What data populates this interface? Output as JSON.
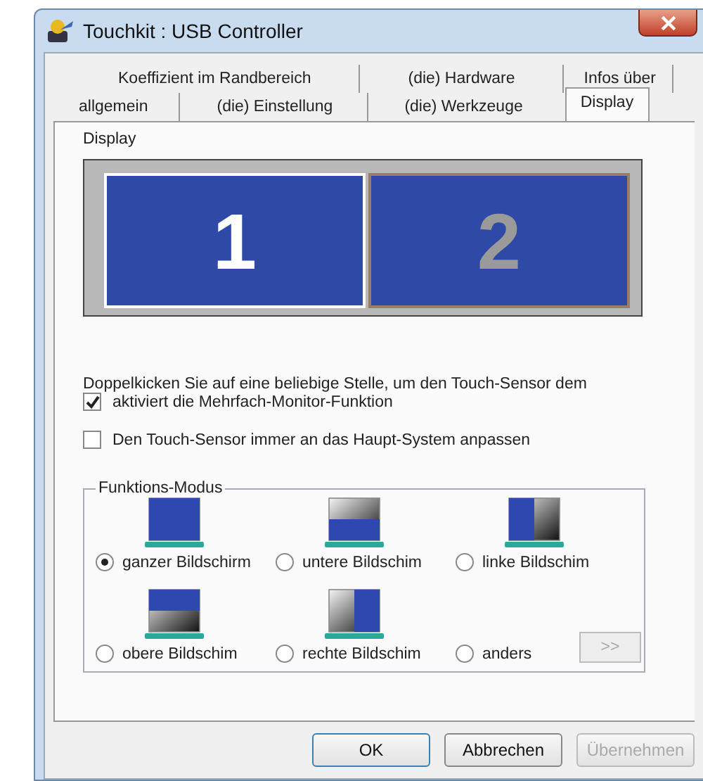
{
  "window": {
    "title": "Touchkit : USB Controller"
  },
  "tab_rows": [
    [
      {
        "label": "Koeffizient im Randbereich",
        "selected": false
      },
      {
        "label": "(die) Hardware",
        "selected": false
      },
      {
        "label": "Infos über",
        "selected": false
      }
    ],
    [
      {
        "label": "allgemein",
        "selected": false
      },
      {
        "label": "(die) Einstellung",
        "selected": false
      },
      {
        "label": "(die) Werkzeuge",
        "selected": false
      },
      {
        "label": "Display",
        "selected": true
      }
    ]
  ],
  "display_group": {
    "title": "Display",
    "monitors": [
      {
        "label": "1",
        "selected": true
      },
      {
        "label": "2",
        "selected": false
      }
    ]
  },
  "instruction": "Doppelkicken Sie auf eine beliebige Stelle, um den Touch-Sensor dem",
  "checkboxes": [
    {
      "label": "aktiviert die Mehrfach-Monitor-Funktion",
      "checked": true
    },
    {
      "label": "Den Touch-Sensor immer an das Haupt-System anpassen",
      "checked": false
    }
  ],
  "mode_group": {
    "title": "Funktions-Modus",
    "options": [
      {
        "label": "ganzer Bildschirm",
        "kind": "full",
        "selected": true
      },
      {
        "label": "untere Bildschim",
        "kind": "bottom",
        "selected": false
      },
      {
        "label": "linke Bildschim",
        "kind": "left",
        "selected": false
      },
      {
        "label": "obere Bildschim",
        "kind": "top",
        "selected": false
      },
      {
        "label": "rechte Bildschim",
        "kind": "right",
        "selected": false
      },
      {
        "label": "anders",
        "kind": "none",
        "selected": false
      }
    ],
    "more_button": {
      "label": ">>",
      "disabled": true
    }
  },
  "buttons": [
    {
      "label": "OK",
      "disabled": false
    },
    {
      "label": "Abbrechen",
      "disabled": false
    },
    {
      "label": "Übernehmen",
      "disabled": true
    }
  ]
}
